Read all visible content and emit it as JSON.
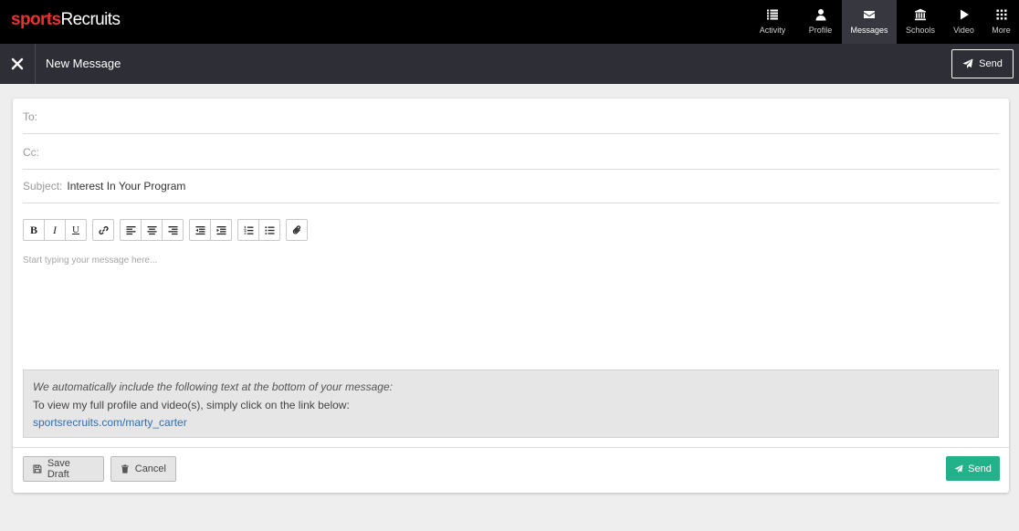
{
  "brand": {
    "logo_part1": "sports",
    "logo_part2": "Recruits"
  },
  "nav": {
    "items": [
      {
        "label": "Activity",
        "icon": "list-icon"
      },
      {
        "label": "Profile",
        "icon": "user-icon"
      },
      {
        "label": "Messages",
        "icon": "envelope-icon",
        "active": true
      },
      {
        "label": "Schools",
        "icon": "institution-icon"
      },
      {
        "label": "Video",
        "icon": "play-icon"
      },
      {
        "label": "More",
        "icon": "grid-icon"
      }
    ]
  },
  "subheader": {
    "title": "New Message",
    "send_label": "Send"
  },
  "compose": {
    "to_label": "To:",
    "to_value": "",
    "cc_label": "Cc:",
    "cc_value": "",
    "subject_label": "Subject:",
    "subject_value": "Interest In Your Program",
    "body_placeholder": "Start typing your message here..."
  },
  "toolbar": {
    "bold": "B",
    "italic": "I",
    "underline": "U"
  },
  "footer_note": {
    "intro": "We automatically include the following text at the bottom of your message:",
    "line": "To view my full profile and video(s), simply click on the link below:",
    "link": "sportsrecruits.com/marty_carter"
  },
  "actions": {
    "save_draft": "Save Draft",
    "cancel": "Cancel",
    "send": "Send"
  },
  "colors": {
    "brand_red": "#e8322f",
    "send_green": "#22b28a",
    "link_blue": "#2f6fb5",
    "topbar": "#000000",
    "subbar": "#2d2e36"
  }
}
